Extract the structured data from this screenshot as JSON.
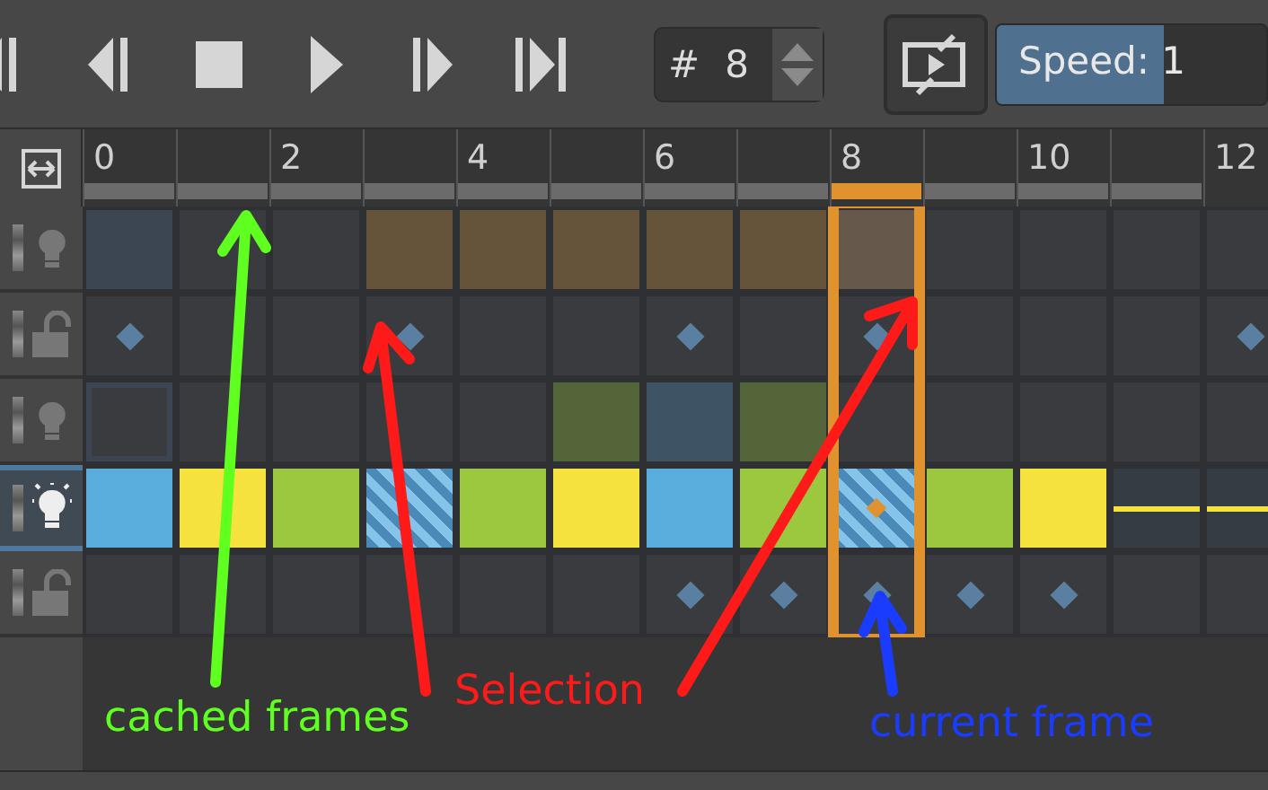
{
  "toolbar": {
    "frame_field": {
      "prefix": "#",
      "value": "8"
    },
    "speed": {
      "label": "Speed: 1",
      "level": 0.62
    }
  },
  "frames": [
    {
      "label": "0",
      "cached": true,
      "selected": false
    },
    {
      "cached": true,
      "selected": false
    },
    {
      "label": "2",
      "cached": true,
      "selected": false
    },
    {
      "cached": true,
      "selected": false
    },
    {
      "label": "4",
      "cached": true,
      "selected": false
    },
    {
      "cached": true,
      "selected": false
    },
    {
      "label": "6",
      "cached": true,
      "selected": false
    },
    {
      "cached": true,
      "selected": false
    },
    {
      "label": "8",
      "cached": true,
      "selected": true
    },
    {
      "cached": true,
      "selected": false
    },
    {
      "label": "10",
      "cached": true,
      "selected": false
    },
    {
      "cached": true,
      "selected": false
    },
    {
      "label": "12",
      "cached": false,
      "selected": false
    }
  ],
  "layers": [
    {
      "kind": "bulb",
      "active": false,
      "cells": [
        {
          "kind": "filled",
          "color": "#3c4653"
        },
        {
          "kind": "blank"
        },
        {
          "kind": "blank"
        },
        {
          "kind": "filled",
          "color": "#65533a"
        },
        {
          "kind": "filled",
          "color": "#65533a"
        },
        {
          "kind": "filled",
          "color": "#65533a"
        },
        {
          "kind": "filled",
          "color": "#65533a"
        },
        {
          "kind": "filled",
          "color": "#65533a"
        },
        {
          "kind": "filled",
          "color": "#66584a"
        },
        {
          "kind": "blank"
        },
        {
          "kind": "blank"
        },
        {
          "kind": "blank"
        },
        {
          "kind": "blank"
        }
      ]
    },
    {
      "kind": "lock",
      "active": false,
      "cells": [
        {
          "kind": "key"
        },
        {
          "kind": "blank"
        },
        {
          "kind": "blank"
        },
        {
          "kind": "key"
        },
        {
          "kind": "blank"
        },
        {
          "kind": "blank"
        },
        {
          "kind": "key"
        },
        {
          "kind": "blank"
        },
        {
          "kind": "key"
        },
        {
          "kind": "blank"
        },
        {
          "kind": "blank"
        },
        {
          "kind": "blank"
        },
        {
          "kind": "key"
        }
      ]
    },
    {
      "kind": "bulb",
      "active": false,
      "cells": [
        {
          "kind": "outlined"
        },
        {
          "kind": "blank"
        },
        {
          "kind": "blank"
        },
        {
          "kind": "blank"
        },
        {
          "kind": "blank"
        },
        {
          "kind": "filled",
          "color": "#55653a"
        },
        {
          "kind": "filled",
          "color": "#3e5465"
        },
        {
          "kind": "filled",
          "color": "#55653a"
        },
        {
          "kind": "blank"
        },
        {
          "kind": "blank"
        },
        {
          "kind": "blank"
        },
        {
          "kind": "blank"
        },
        {
          "kind": "blank"
        }
      ]
    },
    {
      "kind": "bulb",
      "active": true,
      "cells": [
        {
          "kind": "filled",
          "color": "#5aaedd"
        },
        {
          "kind": "filled",
          "color": "#f6e23c"
        },
        {
          "kind": "filled",
          "color": "#9bc83f"
        },
        {
          "kind": "hatched"
        },
        {
          "kind": "filled",
          "color": "#9bc83f"
        },
        {
          "kind": "filled",
          "color": "#f6e23c"
        },
        {
          "kind": "filled",
          "color": "#5aaedd"
        },
        {
          "kind": "filled",
          "color": "#9bc83f"
        },
        {
          "kind": "hatched"
        },
        {
          "kind": "filled",
          "color": "#9bc83f"
        },
        {
          "kind": "filled",
          "color": "#f6e23c"
        },
        {
          "kind": "held"
        },
        {
          "kind": "held"
        }
      ]
    },
    {
      "kind": "lock",
      "active": false,
      "cells": [
        {
          "kind": "blank"
        },
        {
          "kind": "blank"
        },
        {
          "kind": "blank"
        },
        {
          "kind": "blank"
        },
        {
          "kind": "blank"
        },
        {
          "kind": "blank"
        },
        {
          "kind": "key"
        },
        {
          "kind": "key"
        },
        {
          "kind": "key"
        },
        {
          "kind": "key"
        },
        {
          "kind": "key"
        },
        {
          "kind": "blank"
        },
        {
          "kind": "blank"
        }
      ]
    }
  ],
  "annotations": [
    {
      "text": "cached frames",
      "color": "#5fff1f"
    },
    {
      "text": "Selection",
      "color": "#ff1a1a"
    },
    {
      "text": "current frame",
      "color": "#1a3cff"
    }
  ]
}
